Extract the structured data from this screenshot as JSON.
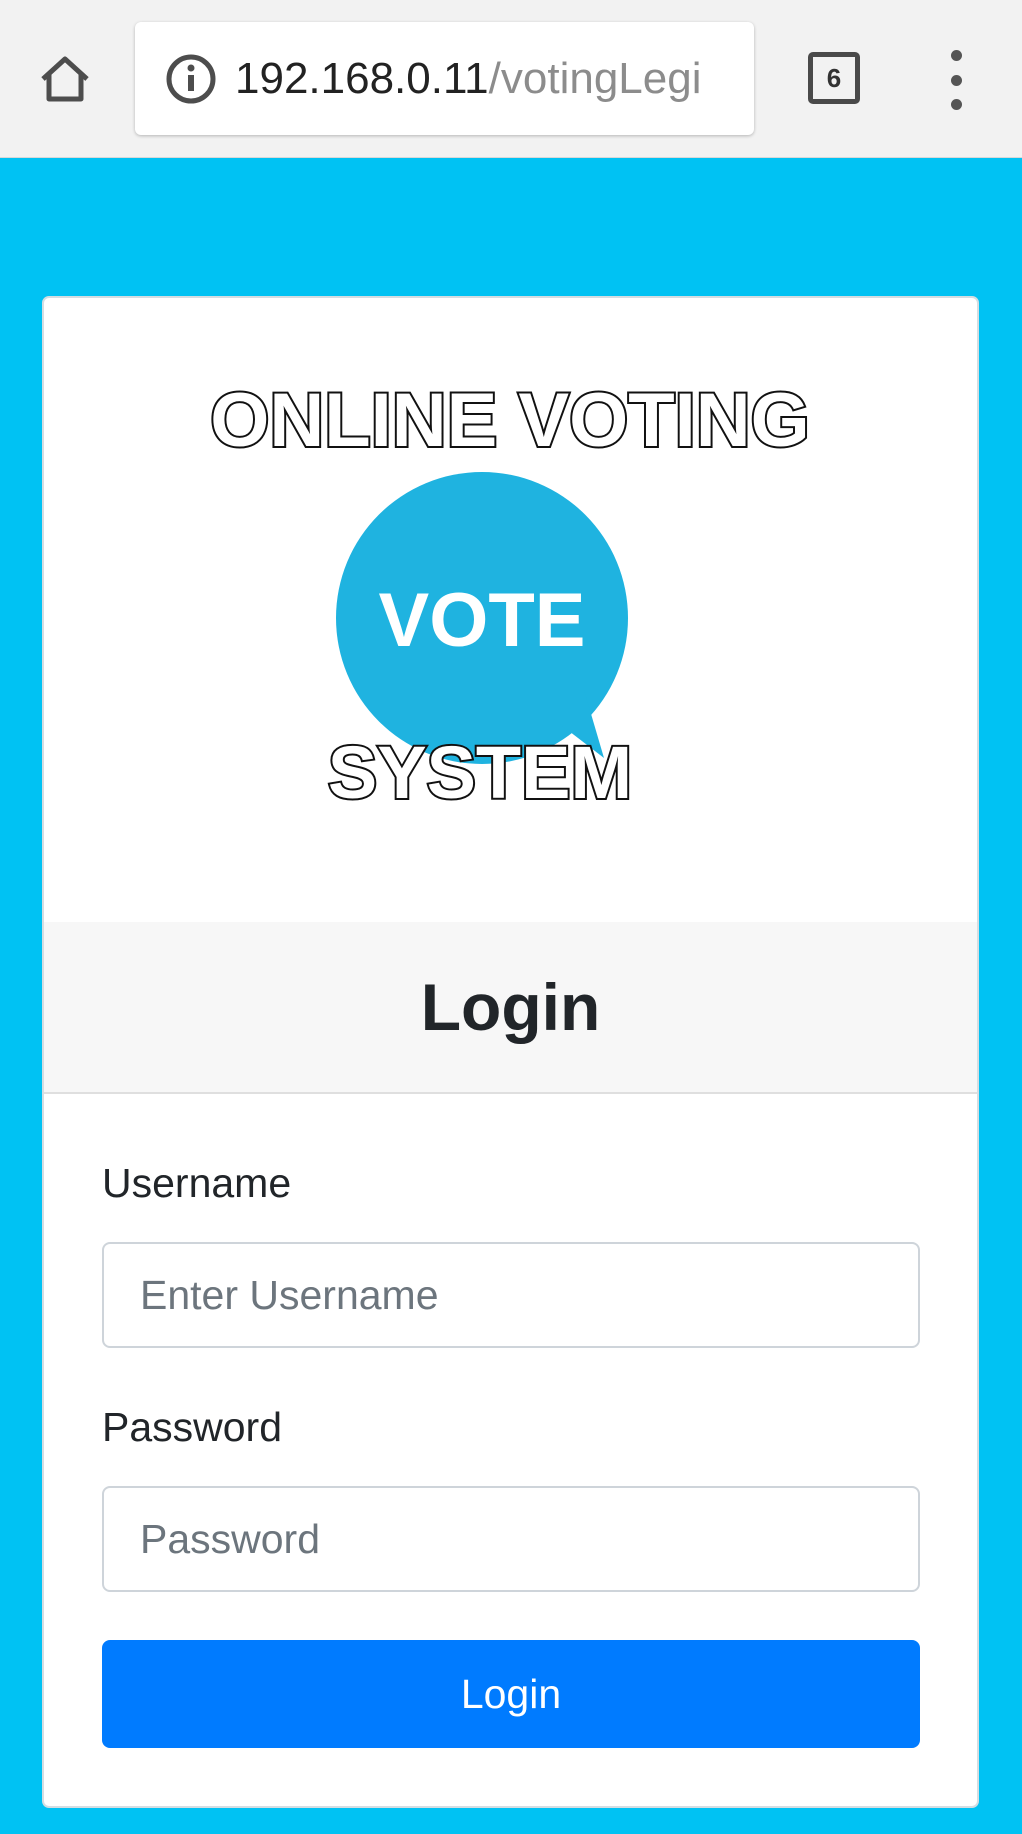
{
  "browser": {
    "url_host": "192.168.0.11",
    "url_path": "/votingLegi",
    "tab_count": "6"
  },
  "logo": {
    "line1": "ONLINE VOTING",
    "bubble_text": "VOTE",
    "line2": "SYSTEM",
    "bubble_color": "#1fb3e0"
  },
  "login": {
    "title": "Login",
    "username_label": "Username",
    "username_placeholder": "Enter Username",
    "password_label": "Password",
    "password_placeholder": "Password",
    "submit_label": "Login"
  },
  "colors": {
    "page_background": "#00c2f3",
    "button": "#007bff"
  }
}
